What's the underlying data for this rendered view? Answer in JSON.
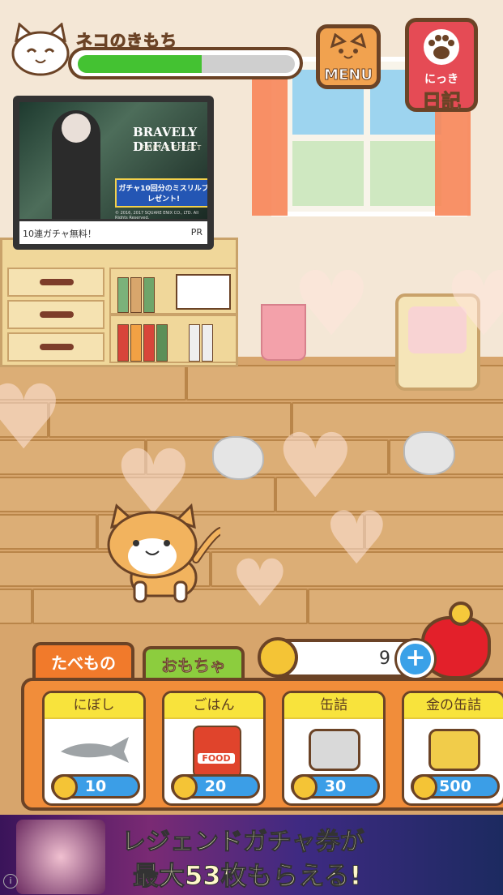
{
  "hud": {
    "mood_label": "ネコのきもち",
    "mood_level": 0.57,
    "menu_label": "MENU",
    "diary_small": "にっき",
    "diary_big": "日記"
  },
  "tv_ad": {
    "brand_title": "BRAVELY DEFAULT",
    "brand_sub": "FAIRY'S EFFECT",
    "promo_text": "ガチャ10回分のミスリルプレゼント!",
    "copyright": "© 2016, 2017 SQUARE ENIX CO., LTD. All Rights Reserved.",
    "caption": "10連ガチャ無料！",
    "pr": "PR"
  },
  "tabs": {
    "food": "たべもの",
    "toy": "おもちゃ"
  },
  "coins": {
    "count": "9",
    "plus": "+"
  },
  "shop_items": [
    {
      "name": "にぼし",
      "price": "10"
    },
    {
      "name": "ごはん",
      "price": "20",
      "bag_label": "FOOD"
    },
    {
      "name": "缶詰",
      "price": "30"
    },
    {
      "name": "金の缶詰",
      "price": "500"
    }
  ],
  "banner": {
    "line1": "レジェンドガチャ券が",
    "line2": "最大53枚もらえる!",
    "info": "i"
  },
  "colors": {
    "accent_orange": "#f18d3a",
    "outline_brown": "#6b4326",
    "mood_green": "#44c232",
    "price_blue": "#3b9ee7"
  }
}
